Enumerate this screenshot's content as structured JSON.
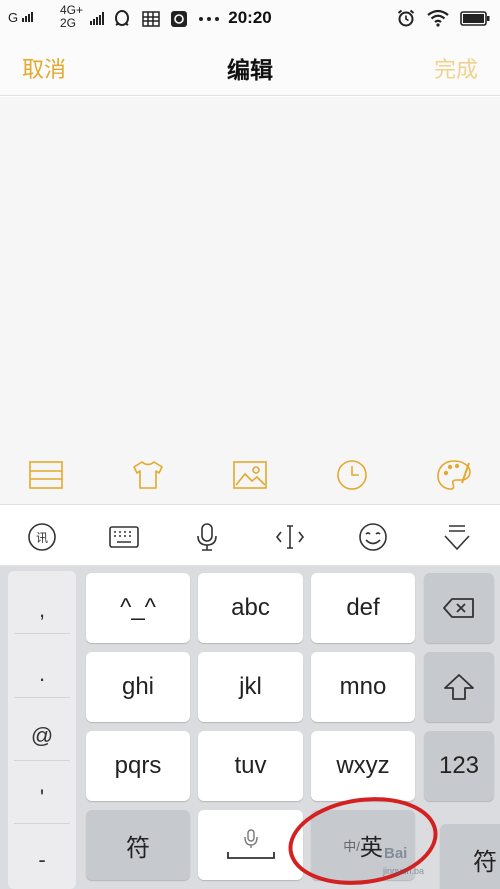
{
  "status_bar": {
    "signal1_label": "G",
    "net_top": "4G+",
    "net_bottom": "2G",
    "time": "20:20",
    "icons": [
      "qq-icon",
      "grid-app-icon",
      "note-app-icon",
      "more-dots-icon",
      "alarm-icon",
      "wifi-icon",
      "battery-icon"
    ]
  },
  "nav": {
    "cancel_label": "取消",
    "title": "编辑",
    "done_label": "完成"
  },
  "editor": {
    "content": ""
  },
  "tool_row": {
    "icons": [
      "checklist-icon",
      "tshirt-icon",
      "image-icon",
      "clock-icon",
      "palette-icon"
    ]
  },
  "ime_toolbar": {
    "icons": [
      "ime-logo-icon",
      "keyboard-icon",
      "microphone-icon",
      "cursor-icon",
      "emoji-icon",
      "hide-keyboard-icon"
    ]
  },
  "keyboard": {
    "punctuation": [
      ",",
      ".",
      "@",
      "'",
      "-"
    ],
    "keys": {
      "k1": "^_^",
      "k2": "abc",
      "k3": "def",
      "k4": "ghi",
      "k5": "jkl",
      "k6": "mno",
      "k7": "pqrs",
      "k8": "tuv",
      "k9": "wxyz",
      "symbol": "符",
      "lang_small": "中/",
      "lang_big": "英",
      "num": "123",
      "symbol_right": "符"
    }
  },
  "watermark": {
    "text": "Bai",
    "sub": "jingyan.ba"
  },
  "colors": {
    "accent": "#e4a92c",
    "accent_disabled": "#f0d28d",
    "annotation": "#d42020"
  }
}
